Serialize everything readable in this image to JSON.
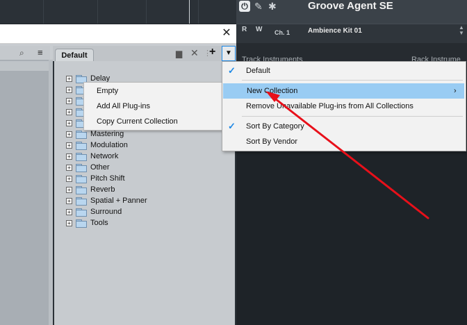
{
  "daw": {
    "instrument_name": "Groove Agent SE",
    "r_label": "R",
    "w_label": "W",
    "channel": "Ch. 1",
    "preset": "Ambience Kit 01",
    "track_instruments": "Track Instruments",
    "rack_instruments": "Rack Instrume"
  },
  "dialog": {
    "close_glyph": "✕"
  },
  "tabs": {
    "default_label": "Default"
  },
  "toolbar": {
    "add_glyph": "+",
    "dropdown_glyph": "▼",
    "close_glyph": "✕"
  },
  "tree": {
    "expander_glyph": "+",
    "items": [
      {
        "label": "Delay"
      },
      {
        "label": ""
      },
      {
        "label": ""
      },
      {
        "label": ""
      },
      {
        "label": ""
      },
      {
        "label": "Mastering"
      },
      {
        "label": "Modulation"
      },
      {
        "label": "Network"
      },
      {
        "label": "Other"
      },
      {
        "label": "Pitch Shift"
      },
      {
        "label": "Reverb"
      },
      {
        "label": "Spatial + Panner"
      },
      {
        "label": "Surround"
      },
      {
        "label": "Tools"
      }
    ]
  },
  "submenu": {
    "items": [
      "Empty",
      "Add All Plug-ins",
      "Copy Current Collection"
    ]
  },
  "dropdown": {
    "default": "Default",
    "new_collection": "New Collection",
    "remove_unavailable": "Remove Unavailable Plug-ins from All Collections",
    "sort_by_category": "Sort By Category",
    "sort_by_vendor": "Sort By Vendor",
    "check_glyph": "✓",
    "submenu_arrow": "›"
  },
  "colors": {
    "accent": "#1e88e5",
    "highlight": "#99ccf3",
    "annotation_arrow": "#e8101a"
  }
}
